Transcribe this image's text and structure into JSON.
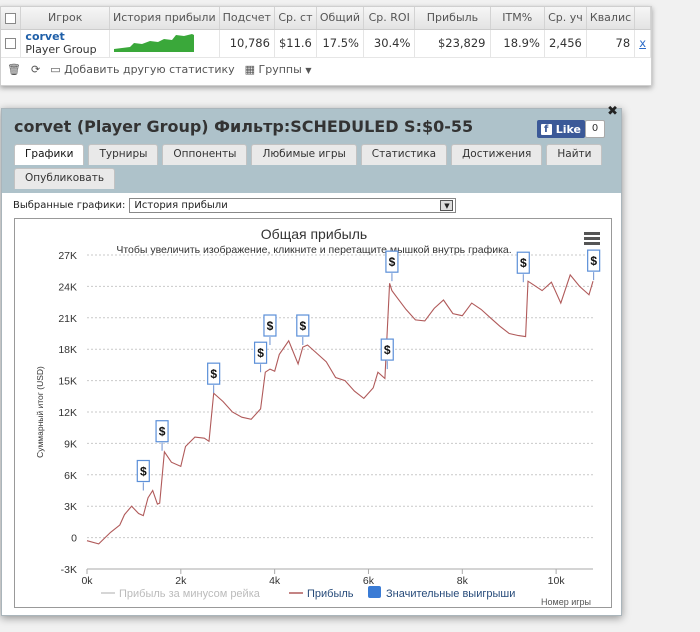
{
  "grid": {
    "columns": [
      "Игрок",
      "История прибыли",
      "Подсчет",
      "Ср. ст",
      "Общий",
      "Ср. ROI",
      "Прибыль",
      "ITM%",
      "Ср. уч",
      "Квалис"
    ],
    "row": {
      "player_name": "corvet",
      "player_group": "Player Group",
      "count": "10,786",
      "avg_stake": "$11.6",
      "total": "17.5%",
      "avg_roi": "30.4%",
      "profit": "$23,829",
      "itm": "18.9%",
      "avg_field": "2,456",
      "qual": "78",
      "action": "x"
    }
  },
  "toolbar": {
    "add_stats": "Добавить другую статистику",
    "groups": "Группы"
  },
  "dialog": {
    "title": "corvet (Player Group) Фильтр:SCHEDULED S:$0-55",
    "fb_like": "Like",
    "fb_count": "0",
    "tabs_row1": [
      "Графики",
      "Турниры",
      "Оппоненты",
      "Любимые игры",
      "Статистика",
      "Достижения",
      "Найти"
    ],
    "tabs_row2": [
      "Опубликовать"
    ],
    "select_label": "Выбранные графики:",
    "select_value": "История прибыли"
  },
  "chart_data": {
    "type": "line",
    "title": "Общая прибыль",
    "subtitle": "Чтобы увеличить изображение, кликните и перетащите мышкой внутрь графика.",
    "ylabel": "Суммарный итог (USD)",
    "xlabel": "Номер игры",
    "xlim": [
      0,
      10786
    ],
    "ylim": [
      -3000,
      27000
    ],
    "xticks": [
      "0k",
      "2k",
      "4k",
      "6k",
      "8k",
      "10k"
    ],
    "yticks": [
      "-3K",
      "0",
      "3K",
      "6K",
      "9K",
      "12K",
      "15K",
      "18K",
      "21K",
      "24K",
      "27K"
    ],
    "grid": true,
    "legend": [
      "Прибыль за минусом рейка",
      "Прибыль",
      "Значительные выигрыши"
    ],
    "legend_placement": "bottom",
    "colors": {
      "profit": "#b05a5a",
      "rake": "#c8c8c8",
      "big_wins": "#3a7bd5"
    },
    "x": [
      0,
      250,
      500,
      700,
      800,
      950,
      1100,
      1200,
      1300,
      1400,
      1500,
      1550,
      1650,
      1800,
      2000,
      2100,
      2300,
      2500,
      2600,
      2700,
      2900,
      3100,
      3300,
      3500,
      3700,
      3800,
      3900,
      4000,
      4100,
      4300,
      4500,
      4600,
      4700,
      4900,
      5100,
      5300,
      5500,
      5700,
      5900,
      6100,
      6200,
      6350,
      6450,
      6500,
      6600,
      6800,
      7000,
      7200,
      7400,
      7600,
      7800,
      8000,
      8200,
      8400,
      8600,
      8800,
      9000,
      9200,
      9350,
      9400,
      9500,
      9700,
      9900,
      10100,
      10300,
      10500,
      10700,
      10786
    ],
    "y": [
      -300,
      -600,
      500,
      1200,
      2200,
      3000,
      2300,
      2100,
      3800,
      4500,
      3200,
      3300,
      8200,
      7200,
      6800,
      8700,
      9600,
      9500,
      9200,
      13800,
      13000,
      12000,
      11500,
      11300,
      12300,
      15800,
      16100,
      15900,
      17500,
      18800,
      16600,
      18200,
      18400,
      17600,
      16800,
      15300,
      15000,
      14000,
      13300,
      14300,
      15800,
      15200,
      24300,
      23600,
      23000,
      21800,
      20800,
      20700,
      21900,
      22700,
      21400,
      21200,
      22400,
      21800,
      21000,
      20200,
      19500,
      19300,
      19200,
      24500,
      24200,
      23600,
      24400,
      22400,
      25100,
      24000,
      23200,
      24500
    ],
    "big_wins_x": [
      1200,
      1600,
      2700,
      3700,
      3900,
      4600,
      6400,
      6500,
      9300,
      10800
    ],
    "big_wins_y": [
      4500,
      8300,
      13800,
      15800,
      18400,
      18400,
      16100,
      24500,
      24400,
      24600
    ]
  }
}
